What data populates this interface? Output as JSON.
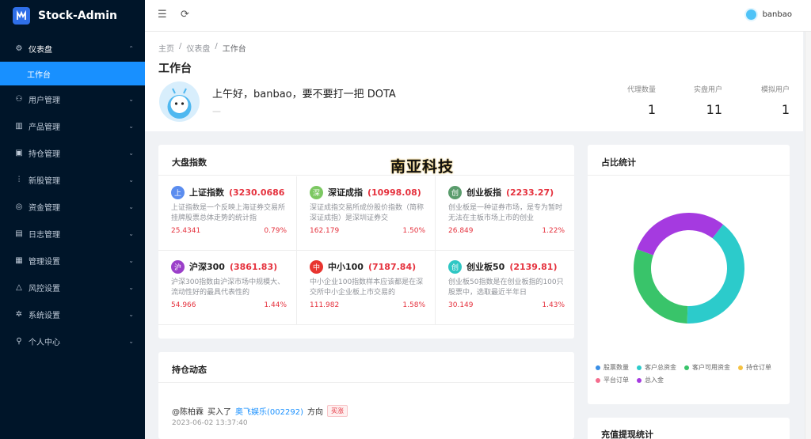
{
  "app": {
    "title": "Stock-Admin"
  },
  "sidebar": {
    "items": [
      {
        "label": "仪表盘",
        "icon": "dashboard-icon",
        "glyph": "⚙",
        "caret": "⌃",
        "state": "open"
      },
      {
        "label": "工作台",
        "state": "active"
      },
      {
        "label": "用户管理",
        "icon": "users-icon",
        "glyph": "⚇",
        "caret": "⌄"
      },
      {
        "label": "产品管理",
        "icon": "product-icon",
        "glyph": "▥",
        "caret": "⌄"
      },
      {
        "label": "持仓管理",
        "icon": "holdings-icon",
        "glyph": "▣",
        "caret": "⌄"
      },
      {
        "label": "新股管理",
        "icon": "ipo-icon",
        "glyph": "⫶",
        "caret": "⌄"
      },
      {
        "label": "资金管理",
        "icon": "money-icon",
        "glyph": "◎",
        "caret": "⌄"
      },
      {
        "label": "日志管理",
        "icon": "log-icon",
        "glyph": "▤",
        "caret": "⌄"
      },
      {
        "label": "管理设置",
        "icon": "manage-icon",
        "glyph": "▦",
        "caret": "⌄"
      },
      {
        "label": "风控设置",
        "icon": "risk-icon",
        "glyph": "△",
        "caret": "⌄"
      },
      {
        "label": "系统设置",
        "icon": "settings-icon",
        "glyph": "✲",
        "caret": "⌄"
      },
      {
        "label": "个人中心",
        "icon": "user-icon",
        "glyph": "⚲",
        "caret": "⌄"
      }
    ]
  },
  "header": {
    "username": "banbao"
  },
  "breadcrumb": {
    "home": "主页",
    "sep": "/",
    "level2": "仪表盘",
    "current": "工作台"
  },
  "page": {
    "title": "工作台",
    "greeting": "上午好，banbao，要不要打一把 DOTA",
    "sub": "—"
  },
  "stats": [
    {
      "label": "代理数量",
      "value": "1"
    },
    {
      "label": "实盘用户",
      "value": "11"
    },
    {
      "label": "模拟用户",
      "value": "1"
    }
  ],
  "market": {
    "title": "大盘指数",
    "indices": [
      {
        "badge": "上",
        "color": "#5b8def",
        "name": "上证指数",
        "value": "(3230.0686",
        "desc": "上证指数是一个反映上海证券交易所挂牌股票总体走势的统计指",
        "change": "25.4341",
        "pct": "0.79%"
      },
      {
        "badge": "深",
        "color": "#7cc862",
        "name": "深证成指",
        "value": "(10998.08)",
        "desc": "深证成指交易所成份股价指数（简称深证成指）是深圳证券交",
        "change": "162.179",
        "pct": "1.50%"
      },
      {
        "badge": "创",
        "color": "#5a9c6c",
        "name": "创业板指",
        "value": "(2233.27)",
        "desc": "创业板是一种证券市场，是专为暂时无法在主板市场上市的创业",
        "change": "26.849",
        "pct": "1.22%"
      },
      {
        "badge": "沪",
        "color": "#9b3fc9",
        "name": "沪深300",
        "value": "(3861.83)",
        "desc": "沪深300指数由沪深市场中规模大、流动性好的最具代表性的",
        "change": "54.966",
        "pct": "1.44%"
      },
      {
        "badge": "中",
        "color": "#e8342f",
        "name": "中小100",
        "value": "(7187.84)",
        "desc": "中小企业100指数样本应该都是在深交所中小企业板上市交易的",
        "change": "111.982",
        "pct": "1.58%"
      },
      {
        "badge": "创",
        "color": "#2fc7c4",
        "name": "创业板50",
        "value": "(2139.81)",
        "desc": "创业板50指数是在创业板指的100只股票中，选取最近半年日",
        "change": "30.149",
        "pct": "1.43%"
      }
    ]
  },
  "holdings": {
    "title": "持仓动态",
    "feed": [
      {
        "user": "@陈柏霖",
        "action": "买入了",
        "stock": "奥飞娱乐(002292)",
        "dir": "方向",
        "tag": "买涨",
        "time": "2023-06-02 13:37:40"
      }
    ]
  },
  "ratio": {
    "title": "占比统计",
    "legend": [
      {
        "label": "股票数量",
        "color": "#3a8ee6"
      },
      {
        "label": "客户总资金",
        "color": "#2ccbcb"
      },
      {
        "label": "客户可用资金",
        "color": "#39c46a"
      },
      {
        "label": "持仓订单",
        "color": "#f5c242"
      },
      {
        "label": "平台订单",
        "color": "#f56c8d"
      },
      {
        "label": "总入金",
        "color": "#a53ae0"
      }
    ]
  },
  "chart_data": {
    "type": "pie",
    "title": "占比统计",
    "labels": [
      "股票数量",
      "客户总资金",
      "客户可用资金",
      "持仓订单",
      "平台订单",
      "总入金"
    ],
    "values": [
      0,
      40,
      30,
      0,
      0,
      30
    ],
    "colors": [
      "#3a8ee6",
      "#2ccbcb",
      "#39c46a",
      "#f5c242",
      "#f56c8d",
      "#a53ae0"
    ],
    "donut": true,
    "legend": "bottom"
  },
  "recharge": {
    "title": "充值提现统计"
  },
  "watermark": "南亚科技"
}
